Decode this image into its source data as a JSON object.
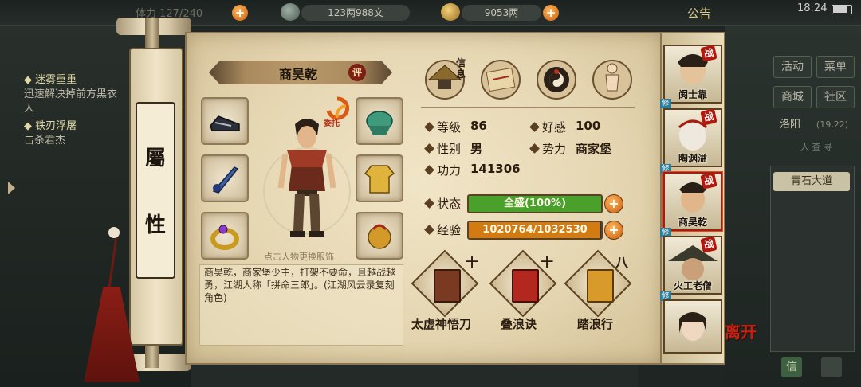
{
  "top_bar": {
    "faded_resource": "体力 127/240",
    "coins": "123两988文",
    "ingots": "9053两",
    "notice": "公告",
    "clock": "18:24"
  },
  "quests": [
    {
      "title": "◆ 迷雾重重",
      "desc": "迅速解决掉前方黑衣人"
    },
    {
      "title": "◆ 铁刃浮屠",
      "desc": "击杀君杰"
    }
  ],
  "right_menu": {
    "items": [
      "活动",
      "菜单",
      "商城",
      "社区"
    ],
    "city": "洛阳",
    "coords": "(19,22)",
    "faded_tab": "人 查 寻",
    "road": "青石大道",
    "letter": "信"
  },
  "scroll": {
    "title_top": "屬",
    "title_bottom": "性"
  },
  "character": {
    "name": "商昊乾",
    "ping": "评",
    "delegate": "委托",
    "change_hint": "点击人物更换服饰",
    "bio": "商昊乾，商家堡少主，打架不要命，且越战越勇，江湖人称「拼命三郎」。(江湖风云录复刻角色)"
  },
  "tabs": {
    "marker": "信息",
    "icons": [
      "bamboo-hat-icon",
      "treasure-map-icon",
      "bagua-icon",
      "meridian-figure-icon"
    ]
  },
  "stats": {
    "level_label": "等级",
    "level": "86",
    "favor_label": "好感",
    "favor": "100",
    "gender_label": "性别",
    "gender": "男",
    "faction_label": "势力",
    "faction": "商家堡",
    "power_label": "功力",
    "power": "141306",
    "state_label": "状态",
    "state": "全盛(100%)",
    "state_fraction": 1.0,
    "exp_label": "经验",
    "exp": "1020764/1032530",
    "exp_fraction": 0.9886
  },
  "skills": [
    {
      "name": "太虚神悟刀",
      "level": "十"
    },
    {
      "name": "叠浪诀",
      "level": "十"
    },
    {
      "name": "踏浪行",
      "level": "八"
    }
  ],
  "party": {
    "members": [
      "阂士靠",
      "陶渊溢",
      "商昊乾",
      "火工老僧",
      ""
    ],
    "badge": "战",
    "tag": "修",
    "leave": "离开"
  },
  "colors": {
    "state_bar": "#49a12c",
    "exp_bar": "#d27b12",
    "accent_red": "#a81c0e"
  }
}
